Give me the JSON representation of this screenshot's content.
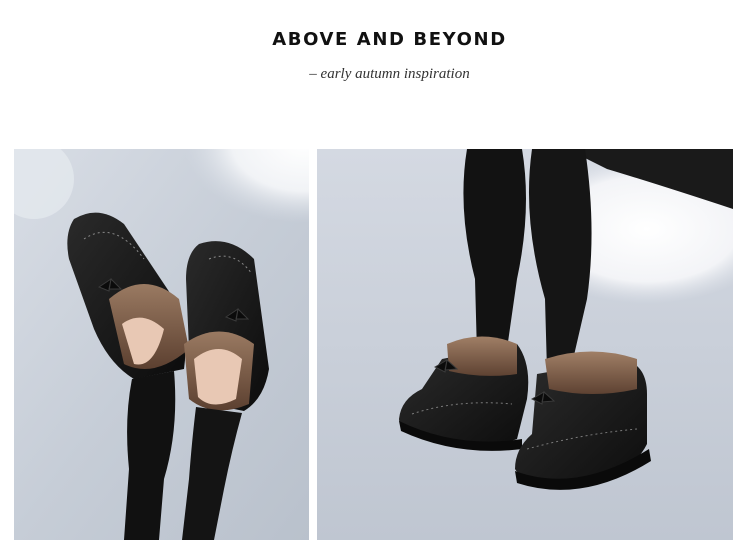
{
  "header": {
    "title": "ABOVE AND BEYOND",
    "subtitle": "– early autumn inspiration"
  },
  "photos": [
    {
      "subject": "two black suede fur-lined flat shoes worn with black leggings, viewed from above on a light blue-grey floor with white fur in background"
    },
    {
      "subject": "legs in black leggings wearing black suede fur-lined ankle shoes with bow laces, white fur rug in background"
    }
  ],
  "colors": {
    "background": "#ffffff",
    "floor": "#c9d0da",
    "shoe": "#141414",
    "fur": "#7a5a44"
  }
}
